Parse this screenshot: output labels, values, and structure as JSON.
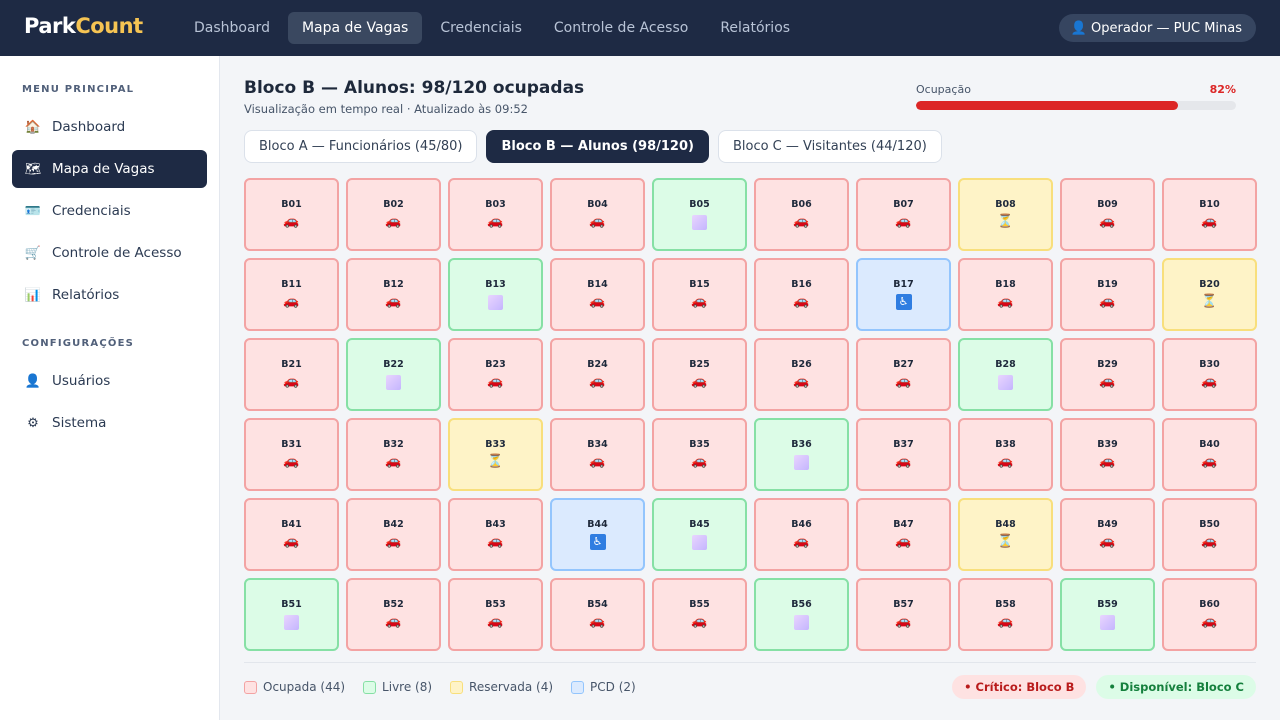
{
  "app": {
    "logo_part1": "Park",
    "logo_part2": "Count"
  },
  "nav": [
    {
      "label": "Dashboard",
      "active": false
    },
    {
      "label": "Mapa de Vagas",
      "active": true
    },
    {
      "label": "Credenciais",
      "active": false
    },
    {
      "label": "Controle de Acesso",
      "active": false
    },
    {
      "label": "Relatórios",
      "active": false
    }
  ],
  "operator": {
    "icon": "👤",
    "label": "Operador — PUC Minas"
  },
  "sidebar": {
    "section_main": "MENU PRINCIPAL",
    "section_config": "CONFIGURAÇÕES",
    "items": [
      {
        "icon": "🏠",
        "icon_name": "home-icon",
        "label": "Dashboard"
      },
      {
        "icon": "🗺",
        "icon_name": "map-icon",
        "label": "Mapa de Vagas"
      },
      {
        "icon": "🪪",
        "icon_name": "id-card-icon",
        "label": "Credenciais"
      },
      {
        "icon": "🛒",
        "icon_name": "cart-icon",
        "label": "Controle de Acesso"
      },
      {
        "icon": "📊",
        "icon_name": "bar-chart-icon",
        "label": "Relatórios"
      },
      {
        "icon": "👤",
        "icon_name": "user-icon",
        "label": "Usuários"
      },
      {
        "icon": "⚙",
        "icon_name": "gear-icon",
        "label": "Sistema"
      }
    ]
  },
  "main": {
    "title": "Bloco B — Alunos: 98/120 ocupadas",
    "subtitle": "Visualização em tempo real · Atualizado às 09:52",
    "occupancy_label": "Ocupação",
    "occupancy_pct_text": "82%",
    "occupancy_fraction": 0.82,
    "occupancy_color": "#dc2626"
  },
  "tabs": [
    {
      "label": "Bloco A — Funcionários (45/80)",
      "active": false
    },
    {
      "label": "Bloco B — Alunos (98/120)",
      "active": true
    },
    {
      "label": "Bloco C — Visitantes (44/120)",
      "active": false
    }
  ],
  "status_icons": {
    "occupied": "🚗",
    "reserved": "⏳",
    "pcd": "♿"
  },
  "slots": [
    {
      "code": "B01",
      "status": "occupied"
    },
    {
      "code": "B02",
      "status": "occupied"
    },
    {
      "code": "B03",
      "status": "occupied"
    },
    {
      "code": "B04",
      "status": "occupied"
    },
    {
      "code": "B05",
      "status": "free"
    },
    {
      "code": "B06",
      "status": "occupied"
    },
    {
      "code": "B07",
      "status": "occupied"
    },
    {
      "code": "B08",
      "status": "reserved"
    },
    {
      "code": "B09",
      "status": "occupied"
    },
    {
      "code": "B10",
      "status": "occupied"
    },
    {
      "code": "B11",
      "status": "occupied"
    },
    {
      "code": "B12",
      "status": "occupied"
    },
    {
      "code": "B13",
      "status": "free"
    },
    {
      "code": "B14",
      "status": "occupied"
    },
    {
      "code": "B15",
      "status": "occupied"
    },
    {
      "code": "B16",
      "status": "occupied"
    },
    {
      "code": "B17",
      "status": "pcd"
    },
    {
      "code": "B18",
      "status": "occupied"
    },
    {
      "code": "B19",
      "status": "occupied"
    },
    {
      "code": "B20",
      "status": "reserved"
    },
    {
      "code": "B21",
      "status": "occupied"
    },
    {
      "code": "B22",
      "status": "free"
    },
    {
      "code": "B23",
      "status": "occupied"
    },
    {
      "code": "B24",
      "status": "occupied"
    },
    {
      "code": "B25",
      "status": "occupied"
    },
    {
      "code": "B26",
      "status": "occupied"
    },
    {
      "code": "B27",
      "status": "occupied"
    },
    {
      "code": "B28",
      "status": "free"
    },
    {
      "code": "B29",
      "status": "occupied"
    },
    {
      "code": "B30",
      "status": "occupied"
    },
    {
      "code": "B31",
      "status": "occupied"
    },
    {
      "code": "B32",
      "status": "occupied"
    },
    {
      "code": "B33",
      "status": "reserved"
    },
    {
      "code": "B34",
      "status": "occupied"
    },
    {
      "code": "B35",
      "status": "occupied"
    },
    {
      "code": "B36",
      "status": "free"
    },
    {
      "code": "B37",
      "status": "occupied"
    },
    {
      "code": "B38",
      "status": "occupied"
    },
    {
      "code": "B39",
      "status": "occupied"
    },
    {
      "code": "B40",
      "status": "occupied"
    },
    {
      "code": "B41",
      "status": "occupied"
    },
    {
      "code": "B42",
      "status": "occupied"
    },
    {
      "code": "B43",
      "status": "occupied"
    },
    {
      "code": "B44",
      "status": "pcd"
    },
    {
      "code": "B45",
      "status": "free"
    },
    {
      "code": "B46",
      "status": "occupied"
    },
    {
      "code": "B47",
      "status": "occupied"
    },
    {
      "code": "B48",
      "status": "reserved"
    },
    {
      "code": "B49",
      "status": "occupied"
    },
    {
      "code": "B50",
      "status": "occupied"
    },
    {
      "code": "B51",
      "status": "free"
    },
    {
      "code": "B52",
      "status": "occupied"
    },
    {
      "code": "B53",
      "status": "occupied"
    },
    {
      "code": "B54",
      "status": "occupied"
    },
    {
      "code": "B55",
      "status": "occupied"
    },
    {
      "code": "B56",
      "status": "free"
    },
    {
      "code": "B57",
      "status": "occupied"
    },
    {
      "code": "B58",
      "status": "occupied"
    },
    {
      "code": "B59",
      "status": "free"
    },
    {
      "code": "B60",
      "status": "occupied"
    }
  ],
  "legend": {
    "occupied": "Ocupada (44)",
    "free": "Livre (8)",
    "reserved": "Reservada (4)",
    "pcd": "PCD (2)"
  },
  "badges": {
    "critical": "• Crítico: Bloco B",
    "available": "• Disponível: Bloco C"
  }
}
